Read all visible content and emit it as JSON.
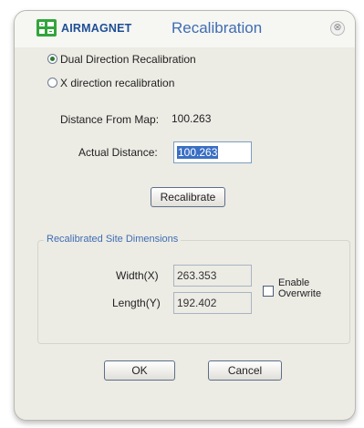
{
  "window": {
    "logo_text": "AIRMAGNET",
    "title": "Recalibration",
    "close_glyph": "⊗"
  },
  "options": {
    "dual": {
      "label": "Dual Direction Recalibration",
      "selected": true
    },
    "x_dir": {
      "label": "X direction recalibration",
      "selected": false
    }
  },
  "distance_from_map": {
    "label": "Distance From Map:",
    "value": "100.263"
  },
  "actual_distance": {
    "label": "Actual Distance:",
    "value": "100.263"
  },
  "recalibrate_button": "Recalibrate",
  "site_dimensions": {
    "legend": "Recalibrated Site Dimensions",
    "width_label": "Width(X)",
    "width_value": "263.353",
    "length_label": "Length(Y)",
    "length_value": "192.402",
    "enable_overwrite_line1": "Enable",
    "enable_overwrite_line2": "Overwrite",
    "enable_overwrite_checked": false
  },
  "ok_button": "OK",
  "cancel_button": "Cancel",
  "icons": {
    "logo": "airmagnet-logo-icon",
    "close": "close-icon"
  },
  "colors": {
    "title": "#3f6db3",
    "logo_green": "#32a53c",
    "logo_text": "#1e4f96",
    "selection": "#3a6fc4"
  }
}
